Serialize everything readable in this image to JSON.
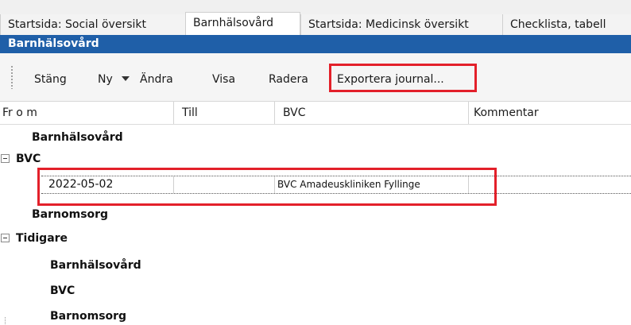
{
  "tabs": [
    {
      "label": "Startsida: Social översikt",
      "active": false
    },
    {
      "label": "Barnhälsovård",
      "active": true
    },
    {
      "label": "Startsida: Medicinsk översikt",
      "active": false
    },
    {
      "label": "Checklista, tabell",
      "active": false
    }
  ],
  "panel": {
    "title": "Barnhälsovård"
  },
  "toolbar": {
    "close_label": "Stäng",
    "new_label": "Ny",
    "edit_label": "Ändra",
    "view_label": "Visa",
    "delete_label": "Radera",
    "export_label": "Exportera journal..."
  },
  "columns": {
    "from": "Fr o m",
    "to": "Till",
    "bvc": "BVC",
    "comment": "Kommentar"
  },
  "tree": {
    "barnhalsovard": "Barnhälsovård",
    "bvc": "BVC",
    "barnomsorg": "Barnomsorg",
    "tidigare": "Tidigare",
    "tidigare_barnhalsovard": "Barnhälsovård",
    "tidigare_bvc": "BVC",
    "tidigare_barnomsorg": "Barnomsorg"
  },
  "bvc_record": {
    "from": "2022-05-02",
    "to": "",
    "bvc": "BVC Amadeuskliniken Fyllinge",
    "comment": ""
  },
  "colors": {
    "title_bar": "#1f5fa8",
    "highlight": "#e3202a"
  }
}
